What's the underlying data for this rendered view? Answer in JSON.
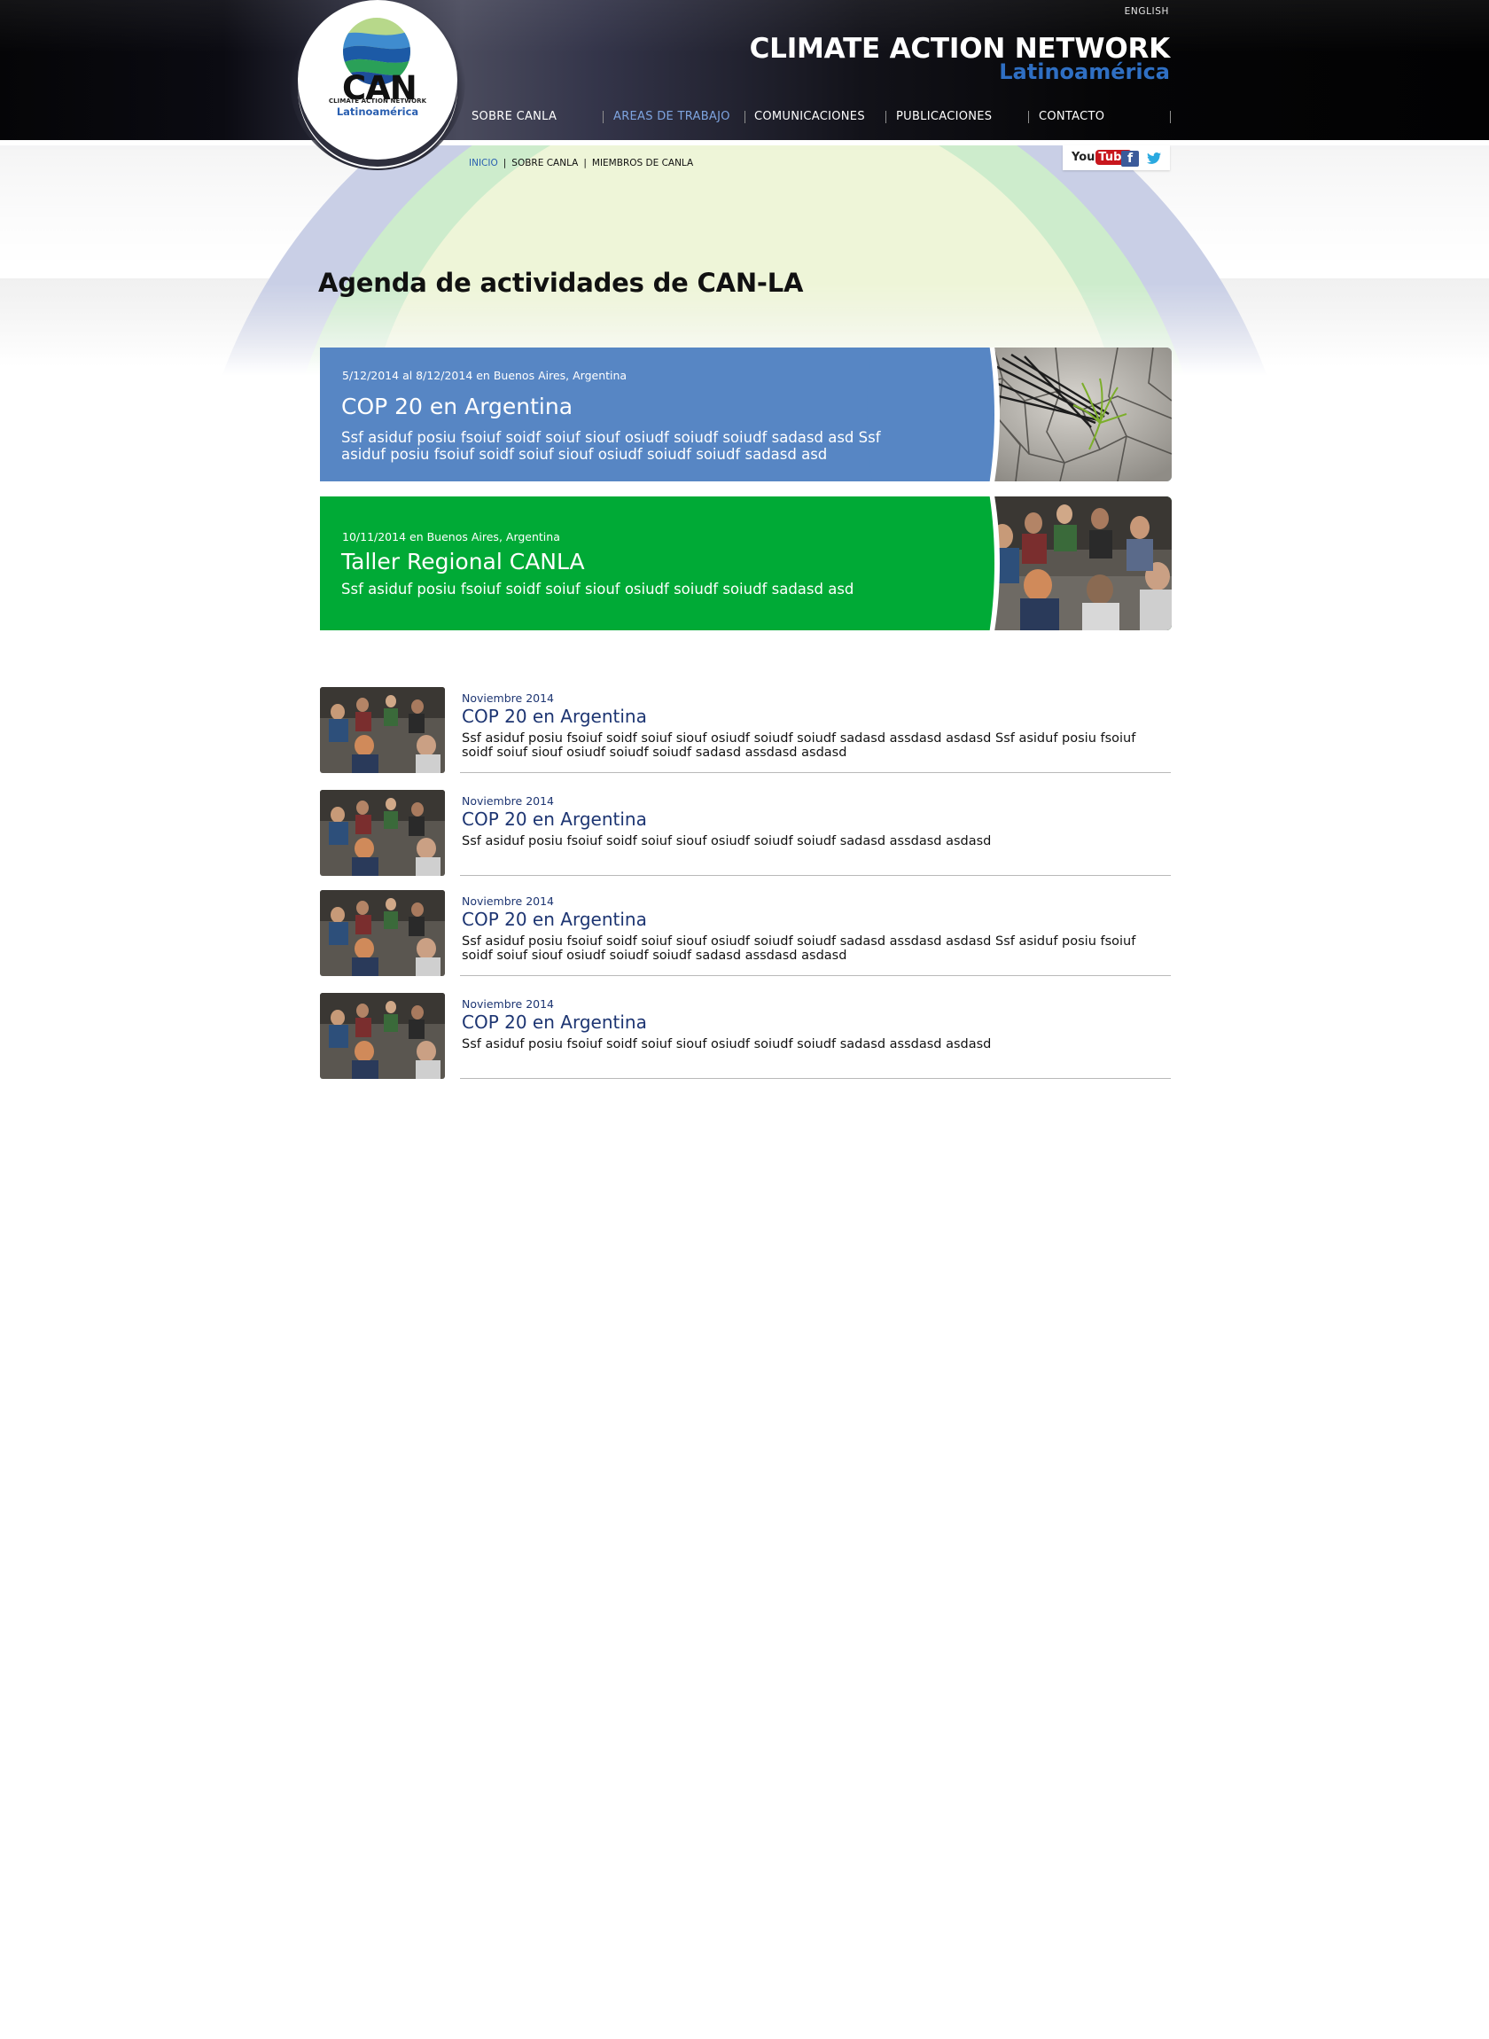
{
  "header": {
    "language_link": "ENGLISH",
    "brand_title": "CLIMATE ACTION NETWORK",
    "brand_subtitle": "Latinoamérica",
    "logo": {
      "acronym": "CAN",
      "small_text": "CLIMATE ACTION NETWORK",
      "region": "Latinoamérica"
    }
  },
  "nav": {
    "items": [
      {
        "label": "SOBRE CANLA",
        "active": false
      },
      {
        "label": "AREAS DE TRABAJO",
        "active": true
      },
      {
        "label": "COMUNICACIONES",
        "active": false
      },
      {
        "label": "PUBLICACIONES",
        "active": false
      },
      {
        "label": "CONTACTO",
        "active": false
      }
    ]
  },
  "breadcrumb": {
    "items": [
      "INICIO",
      "SOBRE CANLA",
      "MIEMBROS DE CANLA"
    ]
  },
  "social": {
    "youtube_you": "You",
    "youtube_tube": "Tube",
    "facebook": "f",
    "icons": [
      "youtube-icon",
      "facebook-icon",
      "twitter-icon"
    ]
  },
  "page": {
    "title": "Agenda de actividades de CAN-LA"
  },
  "featured": [
    {
      "date": "5/12/2014 al 8/12/2014  en Buenos Aires, Argentina",
      "title": "COP 20 en Argentina",
      "description": "Ssf asiduf posiu fsoiuf soidf soiuf siouf osiudf soiudf soiudf sadasd asd Ssf asiduf posiu fsoiuf soidf soiuf siouf osiudf soiudf soiudf sadasd asd",
      "color": "#5786c4",
      "image": "cracked-earth-plant"
    },
    {
      "date": "10/11/2014 en Buenos Aires, Argentina",
      "title": "Taller Regional CANLA",
      "description": "Ssf asiduf posiu fsoiuf soidf soiuf siouf osiudf soiudf soiudf sadasd asd",
      "color": "#00aa36",
      "image": "workshop-group"
    }
  ],
  "events": [
    {
      "month": "Noviembre 2014",
      "title": "COP 20 en Argentina",
      "description": "Ssf asiduf posiu fsoiuf soidf soiuf siouf osiudf soiudf soiudf sadasd assdasd asdasd Ssf asiduf posiu fsoiuf soidf soiuf siouf osiudf soiudf soiudf sadasd assdasd asdasd"
    },
    {
      "month": "Noviembre 2014",
      "title": "COP 20 en Argentina",
      "description": "Ssf asiduf posiu fsoiuf soidf soiuf siouf osiudf soiudf soiudf sadasd assdasd asdasd"
    },
    {
      "month": "Noviembre 2014",
      "title": "COP 20 en Argentina",
      "description": "Ssf asiduf posiu fsoiuf soidf soiuf siouf osiudf soiudf soiudf sadasd assdasd asdasd Ssf asiduf posiu fsoiuf soidf soiuf siouf osiudf soiudf soiudf sadasd assdasd asdasd"
    },
    {
      "month": "Noviembre 2014",
      "title": "COP 20 en Argentina",
      "description": "Ssf asiduf posiu fsoiuf soidf soiuf siouf osiudf soiudf soiudf sadasd assdasd asdasd"
    }
  ],
  "colors": {
    "accent_blue": "#2f6fc3",
    "nav_active": "#7ea4e0",
    "list_title": "#1d3572",
    "banner_blue": "#5786c4",
    "banner_green": "#00aa36"
  }
}
